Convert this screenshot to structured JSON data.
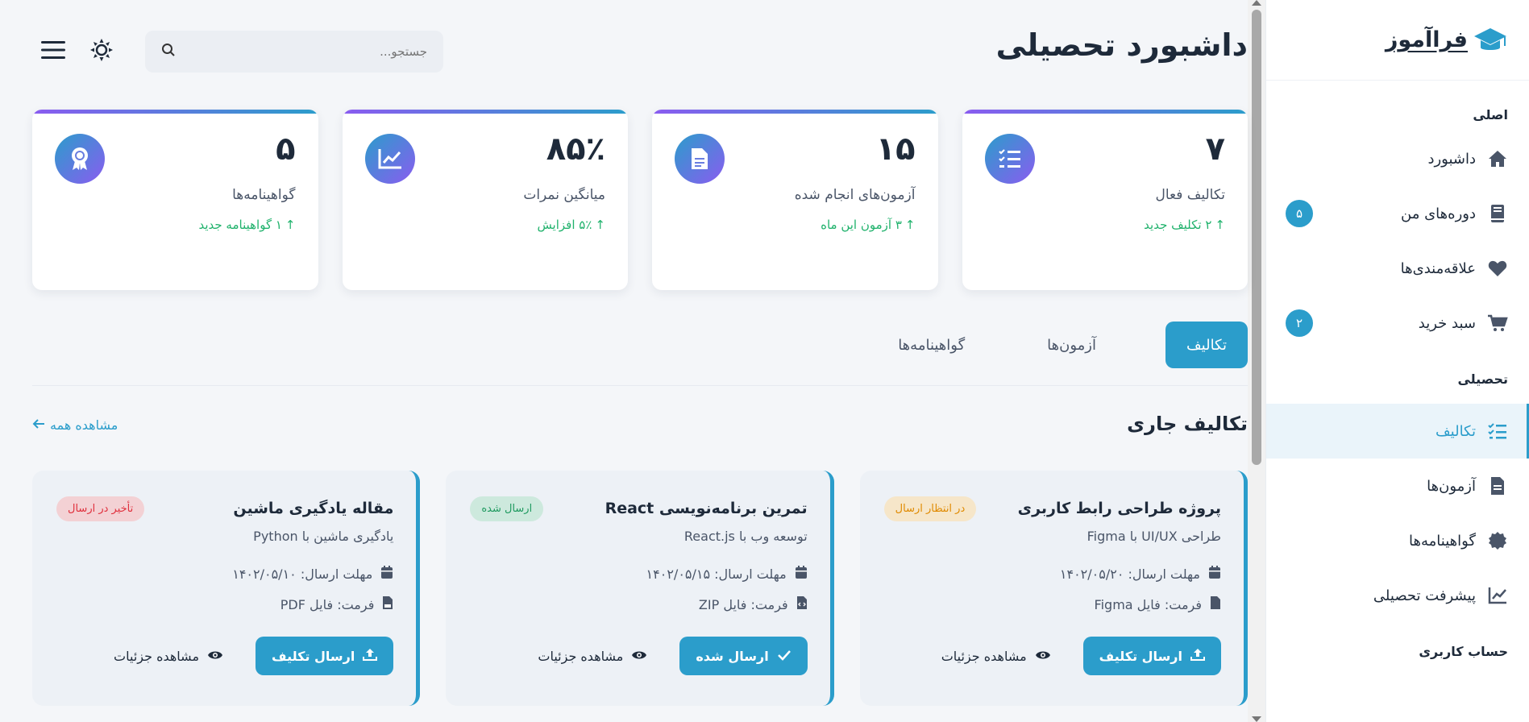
{
  "brand": {
    "name": "فراآموز"
  },
  "sidebar": {
    "sections": [
      "اصلی",
      "تحصیلی",
      "حساب کاربری"
    ],
    "main_items": [
      {
        "label": "داشبورد",
        "icon": "home-icon"
      },
      {
        "label": "دوره‌های من",
        "icon": "book-icon",
        "badge": "۵"
      },
      {
        "label": "علاقه‌مندی‌ها",
        "icon": "heart-icon"
      },
      {
        "label": "سبد خرید",
        "icon": "cart-icon",
        "badge": "۲"
      }
    ],
    "edu_items": [
      {
        "label": "تکالیف",
        "icon": "list-check-icon",
        "active": true
      },
      {
        "label": "آزمون‌ها",
        "icon": "file-icon"
      },
      {
        "label": "گواهینامه‌ها",
        "icon": "certificate-icon"
      },
      {
        "label": "پیشرفت تحصیلی",
        "icon": "chart-line-icon"
      }
    ]
  },
  "header": {
    "title": "داشبورد تحصیلی",
    "search_placeholder": "جستجو..."
  },
  "stats": [
    {
      "value": "۷",
      "label": "تکالیف فعال",
      "change": "۲ تکلیف جدید",
      "icon": "tasks-icon"
    },
    {
      "value": "۱۵",
      "label": "آزمون‌های انجام شده",
      "change": "۳ آزمون این ماه",
      "icon": "document-icon"
    },
    {
      "value": "۸۵٪",
      "label": "میانگین نمرات",
      "change": "۵٪ افزایش",
      "icon": "chart-icon"
    },
    {
      "value": "۵",
      "label": "گواهینامه‌ها",
      "change": "۱ گواهینامه جدید",
      "icon": "award-icon"
    }
  ],
  "tabs": [
    {
      "label": "تکالیف",
      "active": true
    },
    {
      "label": "آزمون‌ها"
    },
    {
      "label": "گواهینامه‌ها"
    }
  ],
  "section": {
    "title": "تکالیف جاری",
    "view_all": "مشاهده همه"
  },
  "assignments": [
    {
      "title": "پروژه طراحی رابط کاربری",
      "status": "در انتظار ارسال",
      "status_type": "pending",
      "course": "طراحی UI/UX با Figma",
      "deadline": "مهلت ارسال: ۱۴۰۲/۰۵/۲۰",
      "format": "فرمت: فایل Figma",
      "primary_label": "ارسال تکلیف",
      "details_label": "مشاهده جزئیات"
    },
    {
      "title": "تمرین برنامه‌نویسی React",
      "status": "ارسال شده",
      "status_type": "sent",
      "course": "توسعه وب با React.js",
      "deadline": "مهلت ارسال: ۱۴۰۲/۰۵/۱۵",
      "format": "فرمت: فایل ZIP",
      "primary_label": "ارسال شده",
      "details_label": "مشاهده جزئیات"
    },
    {
      "title": "مقاله یادگیری ماشین",
      "status": "تأخیر در ارسال",
      "status_type": "late",
      "course": "یادگیری ماشین با Python",
      "deadline": "مهلت ارسال: ۱۴۰۲/۰۵/۱۰",
      "format": "فرمت: فایل PDF",
      "primary_label": "ارسال تکلیف",
      "details_label": "مشاهده جزئیات"
    }
  ],
  "colors": {
    "accent": "#2b9dcb",
    "gradient_end": "#8a5cf0",
    "success": "#20b26c"
  }
}
